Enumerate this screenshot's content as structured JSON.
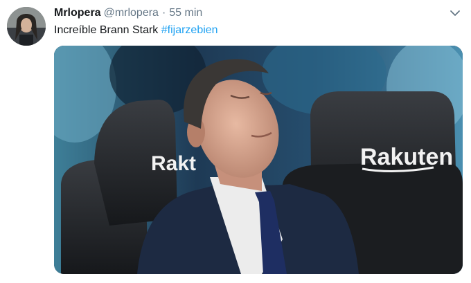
{
  "tweet": {
    "display_name": "Mrlopera",
    "handle": "@mrlopera",
    "separator": "·",
    "timestamp": "55 min",
    "text": "Increíble Brann Stark",
    "hashtag": "#fijarzebien",
    "menu_icon": "chevron-down-icon"
  },
  "media": {
    "seat_sponsor_left": "Rakt",
    "seat_sponsor_right": "Rakuten"
  },
  "colors": {
    "link": "#1da1f2",
    "name": "#14171a",
    "secondary": "#657786"
  }
}
